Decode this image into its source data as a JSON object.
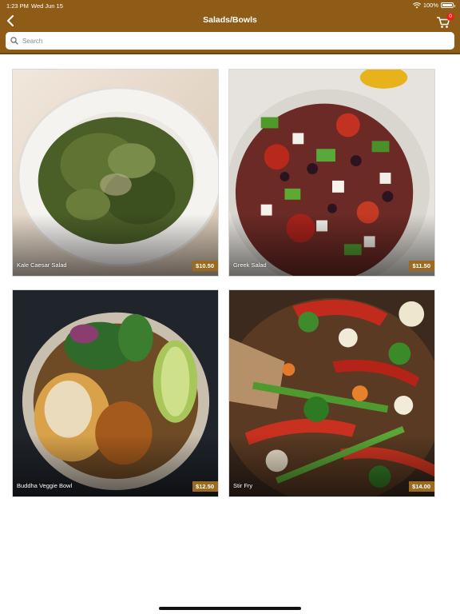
{
  "status_bar": {
    "time": "1:23 PM",
    "date": "Wed Jun 15",
    "battery": "100%"
  },
  "header": {
    "title": "Salads/Bowls",
    "cart_count": "0"
  },
  "search": {
    "placeholder": "Search",
    "value": ""
  },
  "items": [
    {
      "name": "Kale Caesar Salad",
      "price": "$10.50"
    },
    {
      "name": "Greek Salad",
      "price": "$11.50"
    },
    {
      "name": "Buddha Veggie Bowl",
      "price": "$12.50"
    },
    {
      "name": "Stir Fry",
      "price": "$14.00"
    }
  ],
  "colors": {
    "header": "#8e5c17",
    "price_tag": "#9b6a1f",
    "badge": "#e1251b"
  }
}
